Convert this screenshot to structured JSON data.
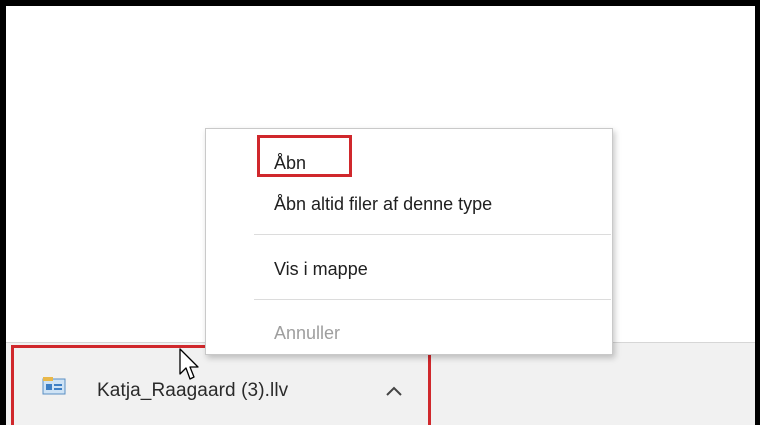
{
  "context_menu": {
    "items": [
      {
        "label": "Åbn",
        "enabled": true
      },
      {
        "label": "Åbn altid filer af denne type",
        "enabled": true
      },
      {
        "label": "Vis i mappe",
        "enabled": true
      },
      {
        "label": "Annuller",
        "enabled": false
      }
    ]
  },
  "download_bar": {
    "file_name": "Katja_Raagaard (3).llv",
    "file_icon": "file-type-icon",
    "expand_icon": "chevron-up-icon"
  },
  "colors": {
    "highlight": "#d0282c",
    "bar_background": "#f1f1f1",
    "disabled_text": "#9e9e9e"
  }
}
